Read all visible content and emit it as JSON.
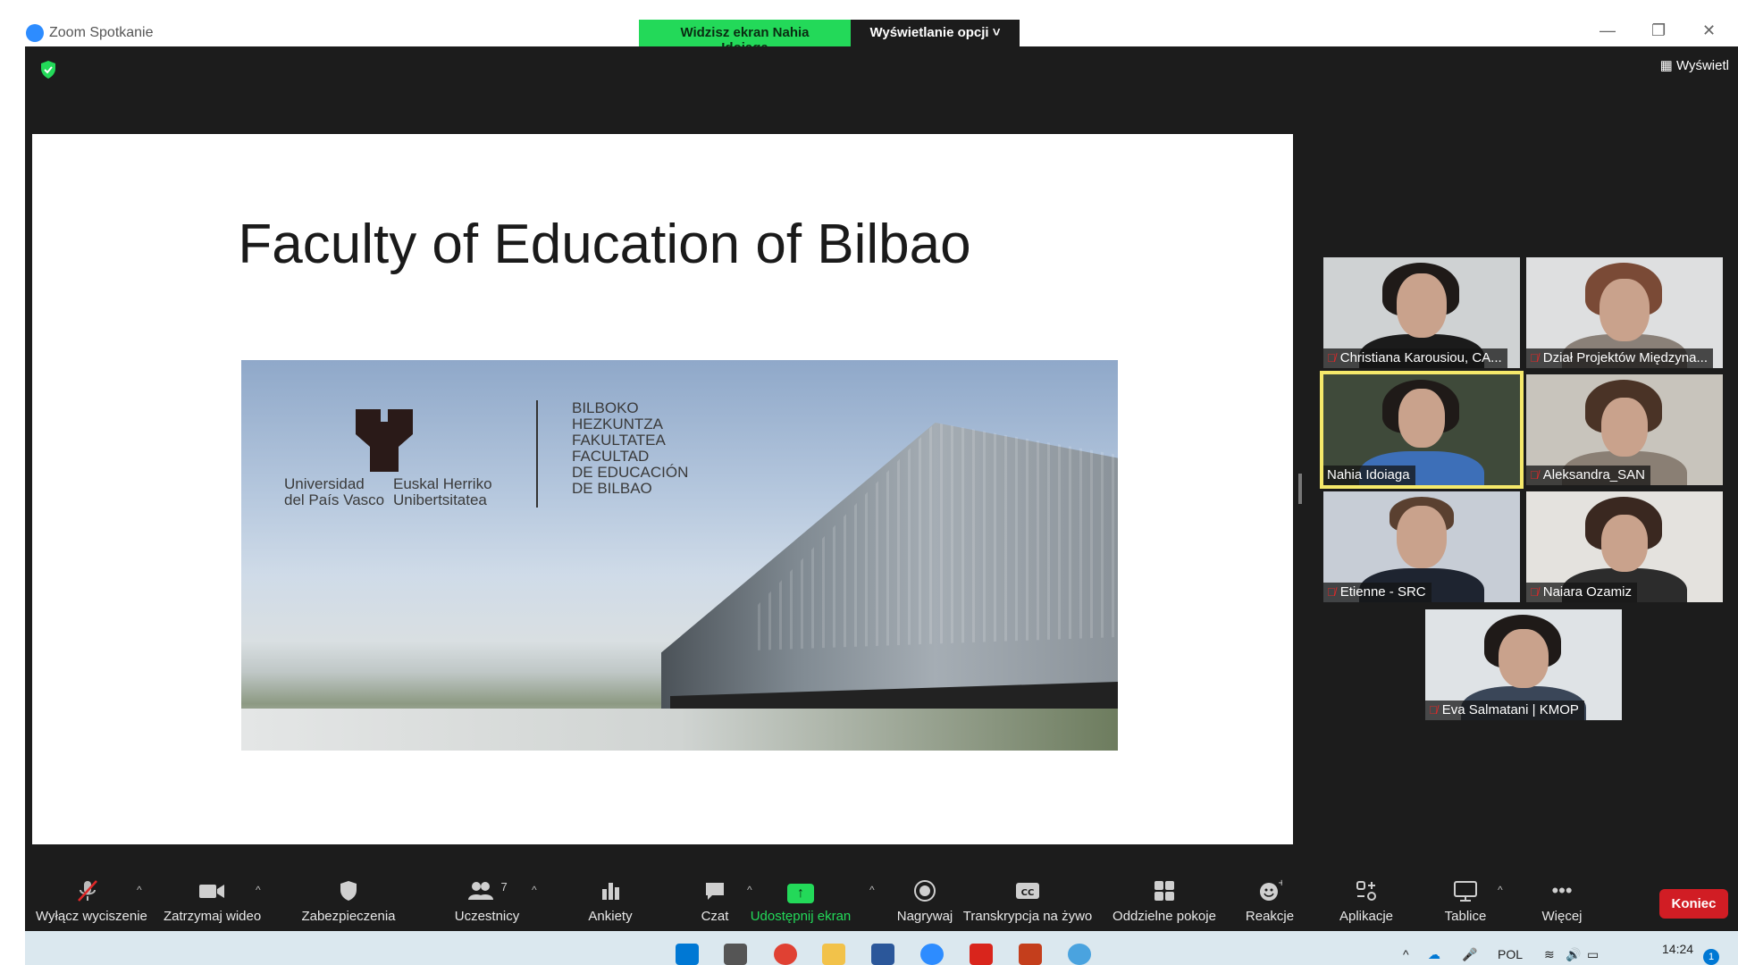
{
  "window": {
    "title": "Zoom Spotkanie",
    "share_banner": "Widzisz ekran Nahia Idoiaga",
    "view_options": "Wyświetlanie opcji ˅",
    "view_button": "Wyświetl"
  },
  "slide": {
    "title": "Faculty of Education of Bilbao",
    "logo_left_1": "Universidad",
    "logo_left_2": "del País Vasco",
    "logo_mid_1": "Euskal Herriko",
    "logo_mid_2": "Unibertsitatea",
    "logo_right_1": "BILBOKO",
    "logo_right_2": "HEZKUNTZA",
    "logo_right_3": "FAKULTATEA",
    "logo_right_4": "FACULTAD",
    "logo_right_5": "DE EDUCACIÓN",
    "logo_right_6": "DE BILBAO"
  },
  "participants": [
    {
      "name": "Christiana Karousiou, CA...",
      "muted": true
    },
    {
      "name": "Dział Projektów Międzyna...",
      "muted": true
    },
    {
      "name": "Nahia Idoiaga",
      "muted": false
    },
    {
      "name": "Aleksandra_SAN",
      "muted": true
    },
    {
      "name": "Etienne - SRC",
      "muted": true
    },
    {
      "name": "Naiara Ozamiz",
      "muted": true
    },
    {
      "name": "Eva Salmatani | KMOP",
      "muted": true
    }
  ],
  "toolbar": {
    "unmute": "Wyłącz wyciszenie",
    "video": "Zatrzymaj wideo",
    "security": "Zabezpieczenia",
    "participants": "Uczestnicy",
    "participants_count": "7",
    "polls": "Ankiety",
    "chat": "Czat",
    "share": "Udostępnij ekran",
    "record": "Nagrywaj",
    "transcript": "Transkrypcja na żywo",
    "breakout": "Oddzielne pokoje",
    "reactions": "Reakcje",
    "apps": "Aplikacje",
    "whiteboards": "Tablice",
    "more": "Więcej",
    "end": "Koniec"
  },
  "taskbar": {
    "lang": "POL",
    "time": "14:24",
    "notif_count": "1"
  },
  "colors": {
    "zoom_blue": "#2d8cff",
    "share_green": "#23d959",
    "end_red": "#d11d24",
    "dark_bg": "#1c1c1c",
    "active_speaker": "#f5e96a"
  }
}
